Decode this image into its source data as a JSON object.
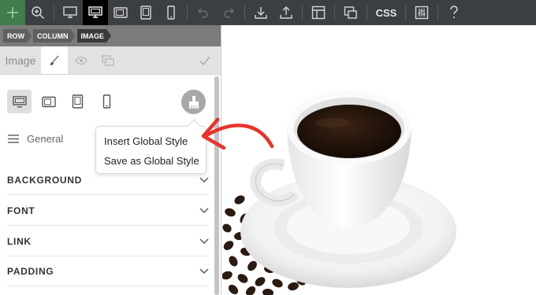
{
  "toolbar": {
    "css_label": "CSS",
    "icons": [
      "plus-icon",
      "zoom-icon",
      "desktop-icon",
      "desktop-active-icon",
      "tablet-landscape-icon",
      "tablet-icon",
      "mobile-icon",
      "undo-icon",
      "redo-icon",
      "import-icon",
      "export-icon",
      "layout-icon",
      "responsive-icon",
      "css-icon",
      "settings-icon",
      "help-icon"
    ]
  },
  "breadcrumb": {
    "items": [
      "ROW",
      "COLUMN",
      "IMAGE"
    ]
  },
  "panel": {
    "tab_title": "Image",
    "general_label": "General",
    "sections": [
      "BACKGROUND",
      "FONT",
      "LINK",
      "PADDING"
    ]
  },
  "context_menu": {
    "items": [
      "Insert Global Style",
      "Save as Global Style"
    ]
  },
  "colors": {
    "toolbar_bg": "#3c3f41",
    "add_button": "#3f7d4c",
    "arrow": "#e8322b"
  }
}
